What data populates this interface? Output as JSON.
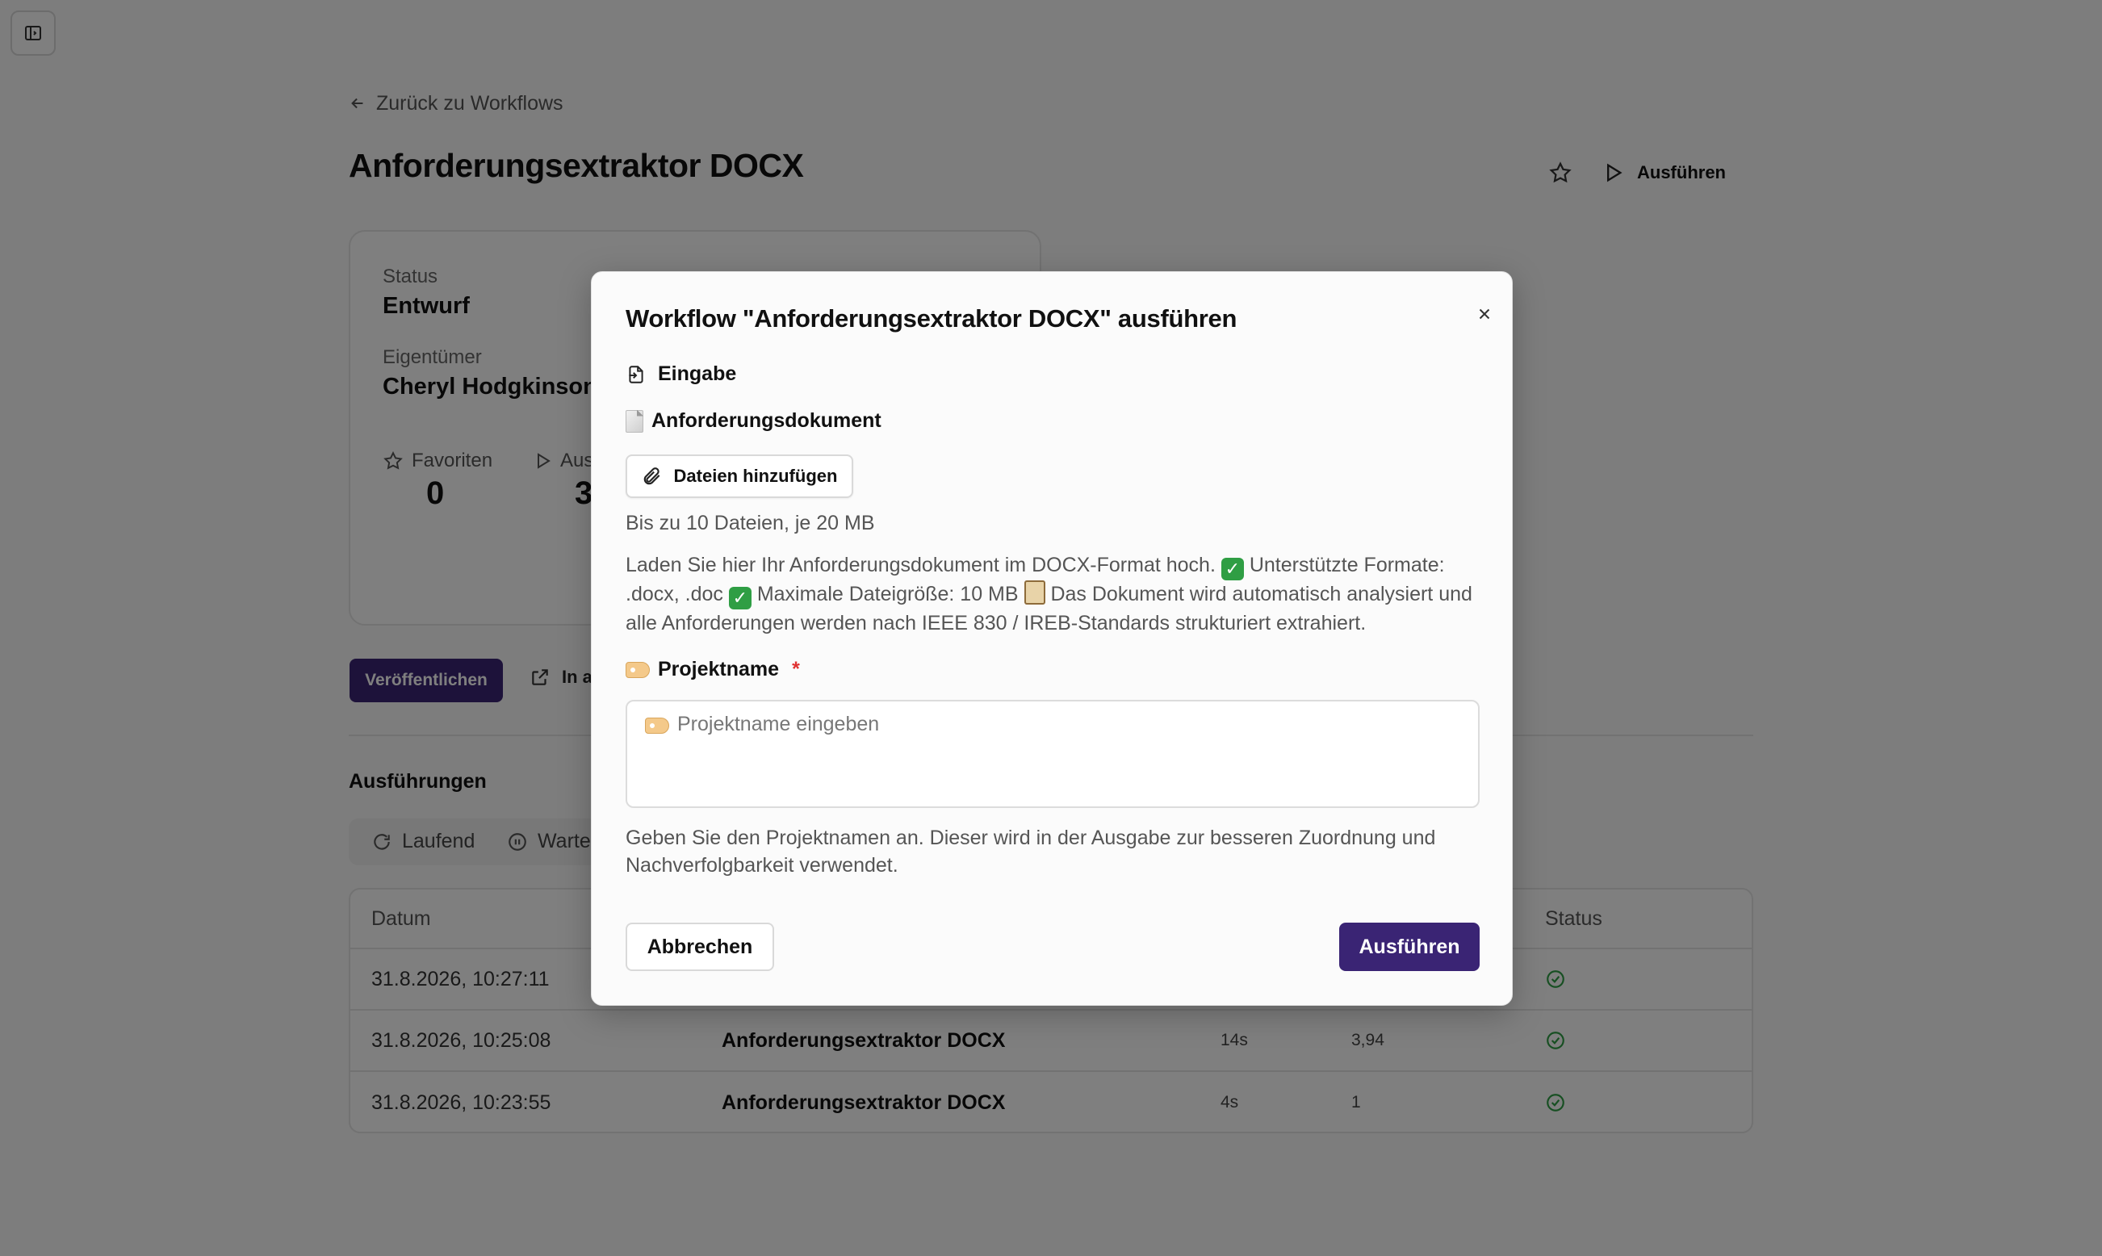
{
  "nav": {
    "back_label": "Zurück zu Workflows"
  },
  "page": {
    "title": "Anforderungsextraktor DOCX",
    "run_label": "Ausführen"
  },
  "info": {
    "status_label": "Status",
    "status_value": "Entwurf",
    "owner_label": "Eigentümer",
    "owner_value": "Cheryl Hodgkinson",
    "favorites_label": "Favoriten",
    "favorites_value": "0",
    "runs_label": "Aus",
    "runs_value": "3"
  },
  "actions": {
    "publish_label": "Veröffentlichen",
    "open_label": "In a"
  },
  "runs": {
    "title": "Ausführungen",
    "filters": [
      "Laufend",
      "Warte"
    ],
    "columns": {
      "date": "Datum",
      "status": "Status"
    },
    "rows": [
      {
        "date": "31.8.2026, 10:27:11",
        "workflow": "",
        "duration": "",
        "value": ""
      },
      {
        "date": "31.8.2026, 10:25:08",
        "workflow": "Anforderungsextraktor DOCX",
        "duration": "14s",
        "value": "3,94"
      },
      {
        "date": "31.8.2026, 10:23:55",
        "workflow": "Anforderungsextraktor DOCX",
        "duration": "4s",
        "value": "1"
      }
    ]
  },
  "modal": {
    "title": "Workflow \"Anforderungsextraktor DOCX\" ausführen",
    "section_label": "Eingabe",
    "doc_field_label": "Anforderungsdokument",
    "add_files_label": "Dateien hinzufügen",
    "file_limit_hint": "Bis zu 10 Dateien, je 20 MB",
    "doc_desc_1": "Laden Sie hier Ihr Anforderungsdokument im DOCX-Format hoch.",
    "doc_desc_2": "Unterstützte Formate: .docx, .doc",
    "doc_desc_3": "Maximale Dateigröße: 10 MB",
    "doc_desc_4": "Das Dokument wird automatisch analysiert und alle Anforderungen werden nach IEEE 830 / IREB-Standards strukturiert extrahiert.",
    "project_field_label": "Projektname",
    "required_mark": "*",
    "project_placeholder": "Projektname eingeben",
    "project_hint": "Geben Sie den Projektnamen an. Dieser wird in der Ausgabe zur besseren Zuordnung und Nachverfolgbarkeit verwendet.",
    "cancel_label": "Abbrechen",
    "submit_label": "Ausführen"
  },
  "colors": {
    "primary": "#3a2474",
    "success": "#2f9e44",
    "required": "#e03131"
  }
}
